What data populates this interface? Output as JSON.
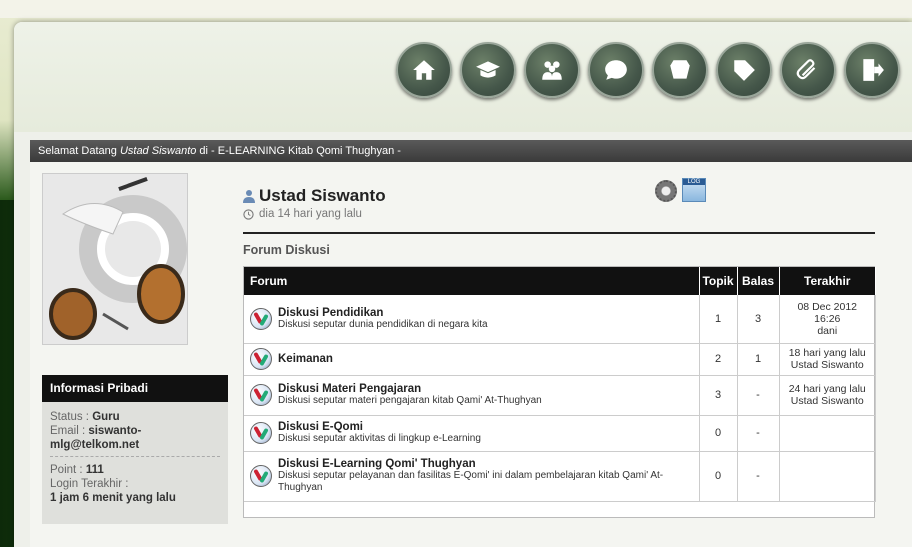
{
  "nav": {
    "items": [
      {
        "icon": "home-icon"
      },
      {
        "icon": "graduation-cap-icon"
      },
      {
        "icon": "users-icon"
      },
      {
        "icon": "chat-bubble-icon"
      },
      {
        "icon": "badge-icon"
      },
      {
        "icon": "tag-icon"
      },
      {
        "icon": "paperclip-icon"
      },
      {
        "icon": "logout-icon"
      }
    ]
  },
  "welcome": {
    "prefix": "Selamat Datang ",
    "name": "Ustad Siswanto",
    "suffix": " di - E-LEARNING Kitab Qomi Thughyan -"
  },
  "profile": {
    "name": "Ustad Siswanto",
    "last_seen": "dia 14 hari yang lalu",
    "log_label": "LOG"
  },
  "info": {
    "title": "Informasi Pribadi",
    "status_label": "Status : ",
    "status_value": "Guru",
    "email_label": "Email : ",
    "email_value": "siswanto-mlg@telkom.net",
    "point_label": "Point : ",
    "point_value": "111",
    "login_label": "Login Terakhir :",
    "login_value": "1 jam 6 menit yang lalu"
  },
  "forum": {
    "section_title": "Forum Diskusi",
    "headers": {
      "forum": "Forum",
      "topik": "Topik",
      "balas": "Balas",
      "terakhir": "Terakhir"
    },
    "rows": [
      {
        "title": "Diskusi Pendidikan",
        "desc": "Diskusi seputar dunia pendidikan di negara kita",
        "topik": "1",
        "balas": "3",
        "last1": "08 Dec 2012",
        "last2": "16:26",
        "last3": "dani"
      },
      {
        "title": "Keimanan",
        "desc": "",
        "topik": "2",
        "balas": "1",
        "last1": "18 hari yang lalu",
        "last2": "Ustad Siswanto",
        "last3": ""
      },
      {
        "title": "Diskusi Materi Pengajaran",
        "desc": "Diskusi seputar materi pengajaran kitab Qami' At-Thughyan",
        "topik": "3",
        "balas": "-",
        "last1": "24 hari yang lalu",
        "last2": "Ustad Siswanto",
        "last3": ""
      },
      {
        "title": "Diskusi E-Qomi",
        "desc": "Diskusi seputar aktivitas di lingkup e-Learning",
        "topik": "0",
        "balas": "-",
        "last1": "",
        "last2": "",
        "last3": ""
      },
      {
        "title": "Diskusi E-Learning Qomi' Thughyan",
        "desc": "Diskusi seputar pelayanan dan fasilitas E-Qomi' ini dalam pembelajaran kitab Qami' At-Thughyan",
        "topik": "0",
        "balas": "-",
        "last1": "",
        "last2": "",
        "last3": ""
      }
    ]
  }
}
